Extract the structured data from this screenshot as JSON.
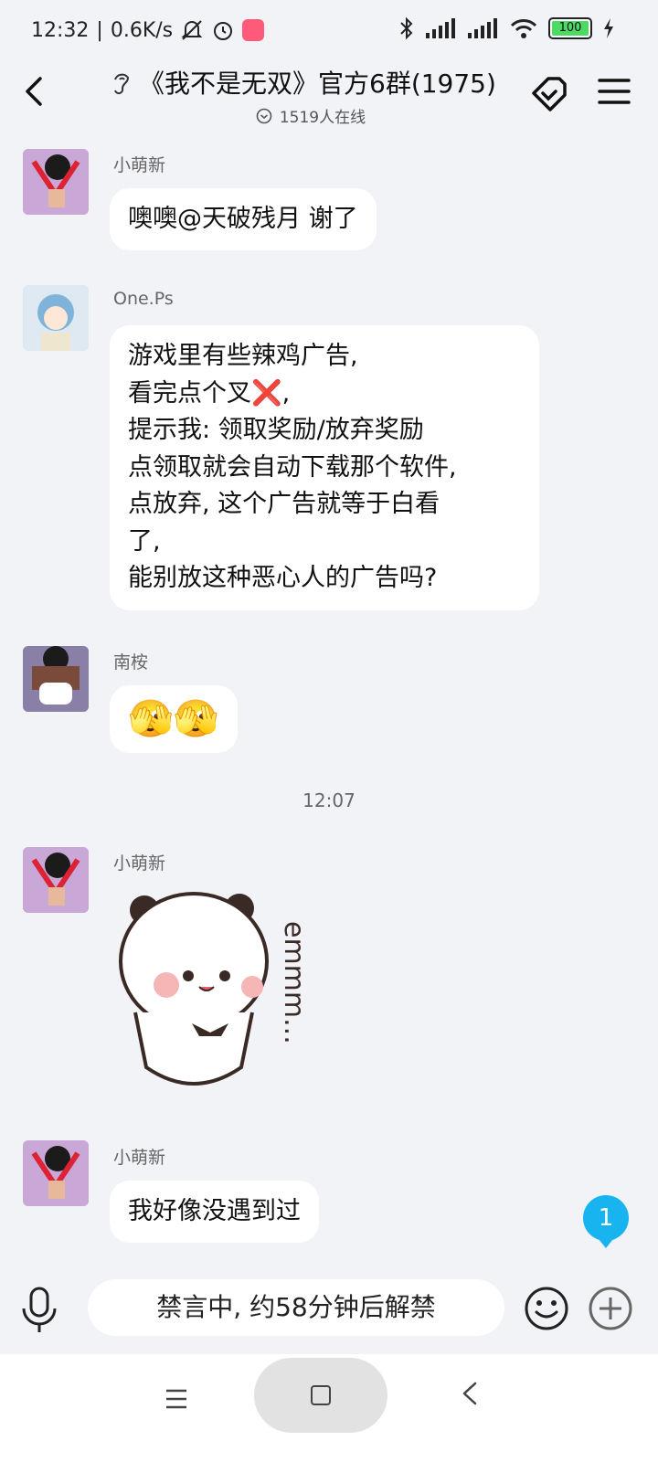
{
  "status_bar": {
    "time": "12:32",
    "separator": "|",
    "net_speed": "0.6K/s",
    "battery": "100"
  },
  "header": {
    "back_icon": "chevron-left-icon",
    "ear_icon": "ear-icon",
    "title": "《我不是无双》官方6群(1975)",
    "online": "1519人在线",
    "right_icons": [
      "tag-exchange-icon",
      "menu-icon"
    ]
  },
  "messages": [
    {
      "sender": "小萌新",
      "text": "噢噢@天破残月 谢了"
    },
    {
      "sender": "One.Ps",
      "lines": [
        "游戏里有些辣鸡广告,",
        "看完点个叉❌,",
        "提示我: 领取奖励/放弃奖励",
        "点领取就会自动下载那个软件,",
        "点放弃, 这个广告就等于白看",
        "了,",
        "能别放这种恶心人的广告吗?"
      ]
    },
    {
      "sender": "南桉",
      "emoji": "🫣🫣"
    },
    {
      "sender": "小萌新",
      "sticker_text": "emmm..."
    },
    {
      "sender": "小萌新",
      "text": "我好像没遇到过"
    }
  ],
  "time_separator": "12:07",
  "unread_badge": "1",
  "input_bar": {
    "muted_text": "禁言中, 约58分钟后解禁"
  }
}
